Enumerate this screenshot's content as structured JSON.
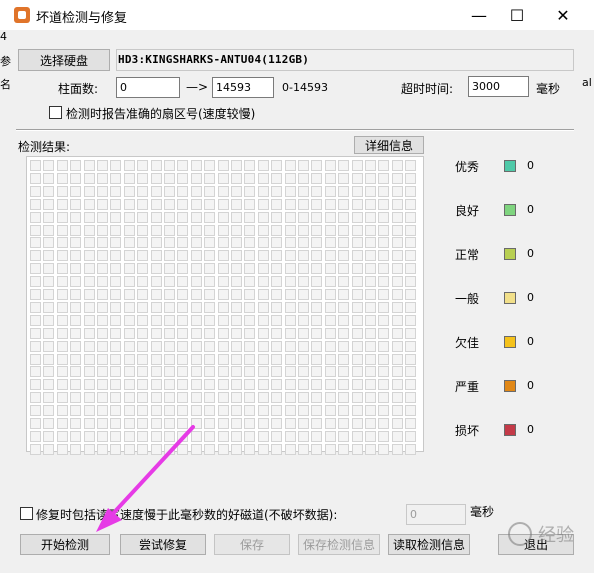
{
  "window": {
    "title": "坏道检测与修复",
    "minimize_glyph": "—",
    "maximize_glyph": "☐",
    "close_glyph": "✕"
  },
  "background_clip": {
    "edge_text_1": "4",
    "edge_text_2": "参",
    "edge_text_3": "名",
    "edge_text_right": "al"
  },
  "top": {
    "select_disk_button": "选择硬盘",
    "disk_info": "HD3:KINGSHARKS-ANTU04(112GB)",
    "cylinder_label": "柱面数:",
    "cylinder_start": "0",
    "arrow": "—>",
    "cylinder_end": "14593",
    "cylinder_range": "0-14593",
    "timeout_label": "超时时间:",
    "timeout_value": "3000",
    "timeout_unit": "毫秒",
    "report_sector_label": "检测时报告准确的扇区号(速度较慢)"
  },
  "results": {
    "label": "检测结果:",
    "details_button": "详细信息"
  },
  "grid": {
    "rows": 23,
    "cols": 29
  },
  "legend": [
    {
      "label": "优秀",
      "color": "#4fc9a8",
      "count": "0"
    },
    {
      "label": "良好",
      "color": "#7fd47f",
      "count": "0"
    },
    {
      "label": "正常",
      "color": "#b8cf52",
      "count": "0"
    },
    {
      "label": "一般",
      "color": "#f2e08a",
      "count": "0"
    },
    {
      "label": "欠佳",
      "color": "#f5c21b",
      "count": "0"
    },
    {
      "label": "严重",
      "color": "#e08716",
      "count": "0"
    },
    {
      "label": "损坏",
      "color": "#c43a48",
      "count": "0"
    }
  ],
  "bottom": {
    "repair_option_label": "修复时包括读写速度慢于此毫秒数的好磁道(不破坏数据):",
    "repair_ms_value": "0",
    "repair_ms_unit": "毫秒",
    "start_button": "开始检测",
    "repair_button": "尝试修复",
    "save_button": "保存",
    "save_results_button": "保存检测信息",
    "load_results_button": "读取检测信息",
    "exit_button": "退出"
  },
  "overlay": {
    "watermark": "经验",
    "arrow_color": "#e63be6"
  }
}
